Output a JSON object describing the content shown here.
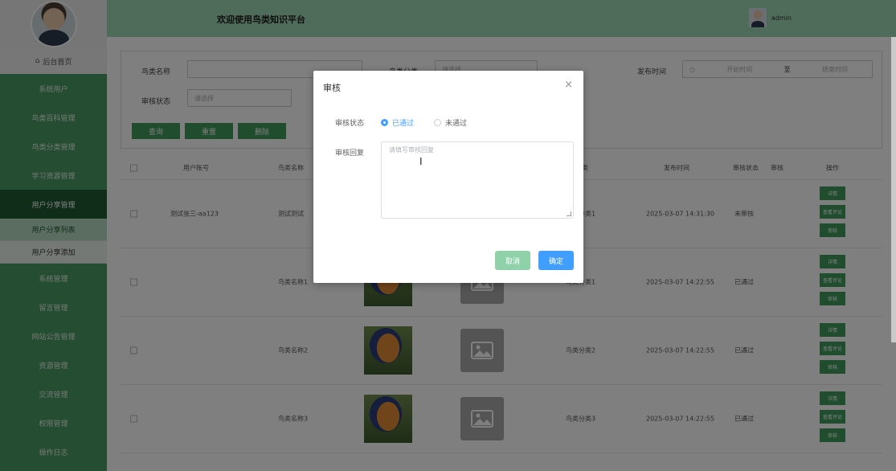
{
  "sidebar": {
    "home": "后台首页",
    "items": [
      "系统用户",
      "鸟类百科管理",
      "鸟类分类管理",
      "学习资源管理",
      "用户分享管理"
    ],
    "subs": [
      "用户分享列表",
      "用户分享添加"
    ],
    "items_after": [
      "系统管理",
      "留言管理",
      "网站公告管理",
      "资源管理",
      "交流管理",
      "权限管理",
      "操作日志"
    ]
  },
  "header": {
    "title": "欢迎使用鸟类知识平台",
    "user": "admin"
  },
  "search": {
    "name_label": "鸟类名称",
    "category_label": "鸟类分类",
    "category_placeholder": "请选择",
    "time_label": "发布时间",
    "start_placeholder": "开始时间",
    "to": "至",
    "end_placeholder": "结束时间",
    "status_label": "审核状态",
    "status_placeholder": "请选择",
    "btn_query": "查询",
    "btn_reset": "重置",
    "btn_delete": "删除"
  },
  "table": {
    "headers": {
      "account": "用户账号",
      "name": "鸟类名称",
      "category": "分类",
      "time": "发布时间",
      "status": "审核状态",
      "review": "审核",
      "ops": "操作"
    },
    "rows": [
      {
        "account": "测试张三-aa123",
        "name": "测试测试",
        "category": "鸟类分类1",
        "time": "2025-03-07 14:31:30",
        "status": "未审核"
      },
      {
        "account": "",
        "name": "鸟类名称1",
        "category": "鸟类分类1",
        "time": "2025-03-07 14:22:55",
        "status": "已通过"
      },
      {
        "account": "",
        "name": "鸟类名称2",
        "category": "鸟类分类2",
        "time": "2025-03-07 14:22:55",
        "status": "已通过"
      },
      {
        "account": "",
        "name": "鸟类名称3",
        "category": "鸟类分类3",
        "time": "2025-03-07 14:22:55",
        "status": "已通过"
      }
    ],
    "op_labels": {
      "detail": "详情",
      "comment": "查看评论",
      "audit": "审核"
    }
  },
  "dialog": {
    "title": "审核",
    "close": "×",
    "status_label": "审核状态",
    "options": [
      "已通过",
      "未通过"
    ],
    "selected": "已通过",
    "reply_label": "审核回复",
    "reply_placeholder": "请填写审核回复",
    "cancel": "取消",
    "confirm": "确定"
  },
  "colors": {
    "primary": "#3f9a5c",
    "sidebar": "#4a9a64",
    "header": "#9fd6b5",
    "cancel": "#8fd1a8",
    "confirm": "#409eff"
  }
}
